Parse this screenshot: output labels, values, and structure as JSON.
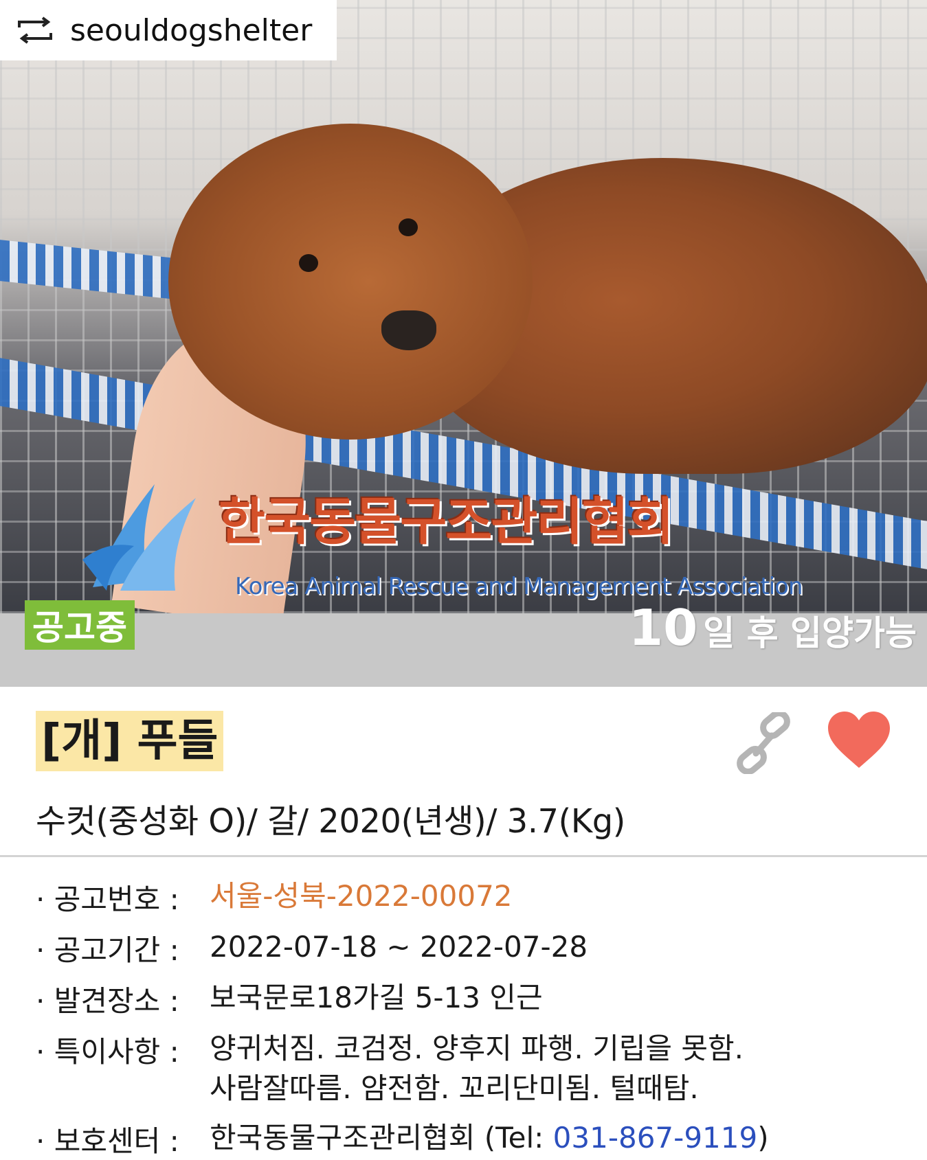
{
  "repost": {
    "username": "seouldogshelter"
  },
  "photo": {
    "watermark_ko": "한국동물구조관리협회",
    "watermark_en": "Korea Animal Rescue and Management Association"
  },
  "status": {
    "badge": "공고중",
    "adopt_days": "10",
    "adopt_suffix": "일 후 입양가능"
  },
  "animal": {
    "species_title": "[개] 푸들",
    "summary": "수컷(중성화 O)/ 갈/ 2020(년생)/ 3.7(Kg)"
  },
  "details": {
    "notice_no_label": "· 공고번호 :",
    "notice_no_value": "서울-성북-2022-00072",
    "period_label": "· 공고기간 :",
    "period_value": "2022-07-18 ~ 2022-07-28",
    "location_label": "· 발견장소 :",
    "location_value": "보국문로18가길 5-13 인근",
    "notes_label": "· 특이사항 :",
    "notes_line1": "양귀처짐. 코검정. 양후지 파행. 기립을 못함.",
    "notes_line2": "사람잘따름. 얌전함. 꼬리단미됨. 털때탐.",
    "center_label": "· 보호센터 :",
    "center_name": "한국동물구조관리협회 (Tel: ",
    "center_tel": "031-867-9119",
    "center_close": ")"
  },
  "colors": {
    "badge_green": "#7fbd3a",
    "notice_orange": "#d97938",
    "tel_blue": "#2b4fbd",
    "heart_red": "#f26a5c",
    "title_highlight": "#fbe7a6"
  },
  "icons": [
    "repost-icon",
    "link-icon",
    "heart-icon",
    "logo-wing-icon"
  ]
}
